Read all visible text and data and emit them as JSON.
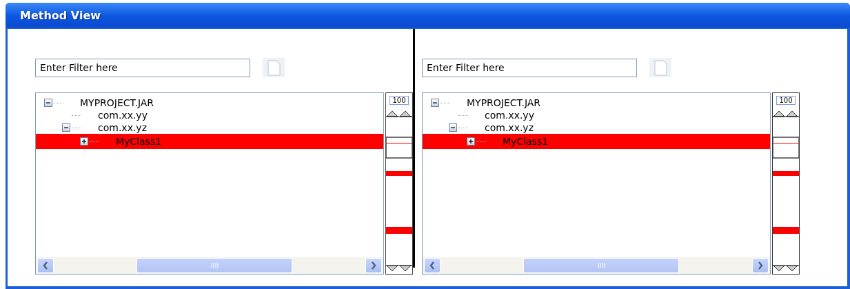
{
  "window": {
    "title": "Method View"
  },
  "panes": [
    {
      "filter": {
        "placeholder": "Enter Filter here"
      },
      "tree": [
        {
          "label": "MYPROJECT.JAR",
          "expanded": true,
          "selected": false,
          "children": [
            {
              "label": "com.xx.yy",
              "selected": false
            },
            {
              "label": "com.xx.yz",
              "expanded": true,
              "selected": false,
              "children": [
                {
                  "label": "MyClass1",
                  "expanded": false,
                  "selected": true
                }
              ]
            }
          ]
        }
      ],
      "overview": {
        "zoom": "100"
      }
    },
    {
      "filter": {
        "placeholder": "Enter Filter here"
      },
      "tree": [
        {
          "label": "MYPROJECT.JAR",
          "expanded": true,
          "selected": false,
          "children": [
            {
              "label": "com.xx.yy",
              "selected": false
            },
            {
              "label": "com.xx.yz",
              "expanded": true,
              "selected": false,
              "children": [
                {
                  "label": "MyClass1",
                  "expanded": false,
                  "selected": true
                }
              ]
            }
          ]
        }
      ],
      "overview": {
        "zoom": "100"
      }
    }
  ]
}
